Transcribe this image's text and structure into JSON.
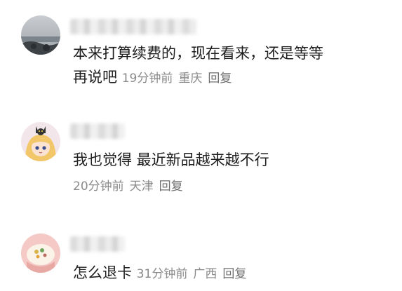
{
  "comments": [
    {
      "avatar": "ocean-rock-photo",
      "text_line1": "本来打算续费的，现在看来，还是等等",
      "text_line2": "再说吧",
      "time": "19分钟前",
      "location": "重庆",
      "reply_label": "回复"
    },
    {
      "avatar": "anime-girl-with-cat",
      "text": "我也觉得 最近新品越来越不行",
      "time": "20分钟前",
      "location": "天津",
      "reply_label": "回复"
    },
    {
      "avatar": "rice-bowl-photo",
      "text": "怎么退卡",
      "time": "31分钟前",
      "location": "广西",
      "reply_label": "回复"
    }
  ]
}
